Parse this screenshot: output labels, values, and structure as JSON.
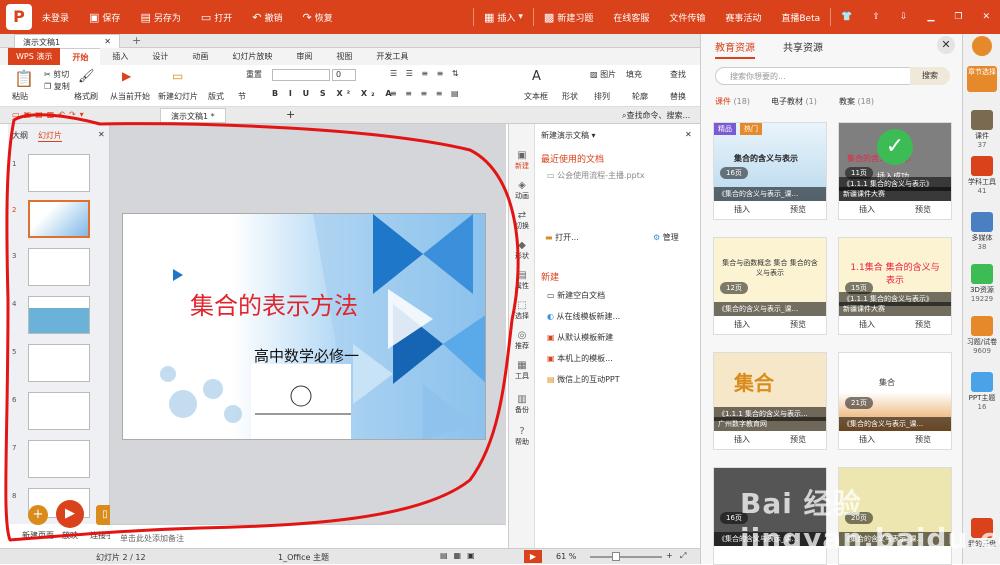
{
  "titlebar": {
    "login": "未登录",
    "save": "保存",
    "save_as": "另存为",
    "open": "打开",
    "undo": "撤销",
    "redo": "恢复",
    "insert": "插入",
    "new_exercise": "新建习题",
    "online_service": "在线客服",
    "file_transfer": "文件传输",
    "contest": "赛事活动",
    "live": "直播Beta"
  },
  "doc_tab": "演示文稿1",
  "ribbon_tabs": [
    "WPS 演示",
    "开始",
    "插入",
    "设计",
    "动画",
    "幻灯片放映",
    "审阅",
    "视图",
    "开发工具"
  ],
  "ribbon": {
    "paste": "粘贴",
    "cut": "剪切",
    "copy": "复制",
    "format_painter": "格式刷",
    "from_current": "从当前开始",
    "new_slide": "新建幻灯片",
    "layout": "版式",
    "section": "节",
    "reset": "重置",
    "font_size": "0",
    "textbox": "文本框",
    "shape": "形状",
    "picture": "图片",
    "fill": "填充",
    "arrange": "排列",
    "outline": "轮廓",
    "find": "查找",
    "replace": "替换"
  },
  "qbar": {
    "doc_tab": "演示文稿1 *",
    "search": "查找命令、搜索..."
  },
  "left_panel": {
    "tab_outline": "大纲",
    "tab_slides": "幻灯片",
    "slide_numbers": [
      "1",
      "2",
      "3",
      "4",
      "5",
      "6",
      "7",
      "8"
    ]
  },
  "slide": {
    "title": "集合的表示方法",
    "subtitle": "高中数学必修一"
  },
  "bottom_actions": {
    "new_page": "新建页面",
    "play": "放映",
    "connect_phone": "连接手机"
  },
  "notes": "单击此处添加备注",
  "vtools": [
    "新建",
    "动画",
    "切换",
    "形状",
    "属性",
    "选择",
    "推荐",
    "工具",
    "备份",
    "帮助"
  ],
  "new_panel": {
    "header": "新建演示文稿",
    "recent": "最近使用的文档",
    "recent_file": "公会使用流程-主播.pptx",
    "open": "打开...",
    "manage": "管理",
    "new": "新建",
    "items": [
      "新建空白文档",
      "从在线模板新建...",
      "从默认模板新建",
      "本机上的模板...",
      "微信上的互动PPT"
    ]
  },
  "status": {
    "slide_count": "幻灯片 2 / 12",
    "theme": "1_Office 主题",
    "zoom": "61 %"
  },
  "edu": {
    "tab_edu": "教育资源",
    "tab_shared": "共享资源",
    "search_placeholder": "搜索你想要的...",
    "search_button": "搜索",
    "filters": [
      {
        "label": "课件",
        "count": "(18)"
      },
      {
        "label": "电子教材",
        "count": "(1)"
      },
      {
        "label": "教案",
        "count": "(18)"
      }
    ],
    "insert_label": "插入",
    "preview_label": "预览",
    "insert_success": "插入成功",
    "cards": [
      {
        "title": "集合的含义与表示",
        "pages": "16页",
        "caption": "《集合的含义与表示_课...",
        "badge1": "精品",
        "badge2": "热门"
      },
      {
        "title": "集合的含义与表示",
        "pages": "11页",
        "caption": "《1.1.1 集合的含义与表示》",
        "sub": "新疆课件大赛"
      },
      {
        "title": "集合与函数概念 集合 集合的含义与表示",
        "pages": "12页",
        "caption": "《集合的含义与表示_课..."
      },
      {
        "title": "1.1集合 集合的含义与表示",
        "pages": "15页",
        "caption": "《1.1.1 集合的含义与表示》",
        "sub": "新疆课件大赛"
      },
      {
        "title": "集合",
        "pages": "",
        "caption": "《1.1.1 集合的含义与表示...",
        "sub": "广州数字教育网"
      },
      {
        "title": "集合",
        "pages": "21页",
        "caption": "《集合的含义与表示_课..."
      },
      {
        "title": "",
        "pages": "16页",
        "caption": "《集合的含义与表示_课..."
      },
      {
        "title": "",
        "pages": "20页",
        "caption": "《集合的含义与表示_课..."
      }
    ]
  },
  "sidebar": [
    {
      "label": "课件",
      "count": "37"
    },
    {
      "label": "学科工具",
      "count": "41"
    },
    {
      "label": "多媒体",
      "count": "38"
    },
    {
      "label": "3D资源",
      "count": "19229"
    },
    {
      "label": "习题/试卷",
      "count": "9609"
    },
    {
      "label": "PPT主题",
      "count": "16"
    },
    {
      "label": "我的云盘",
      "count": ""
    }
  ],
  "sidebar_top": "章节选择",
  "watermark": "Bai 经验 jingyan.baidu.com"
}
